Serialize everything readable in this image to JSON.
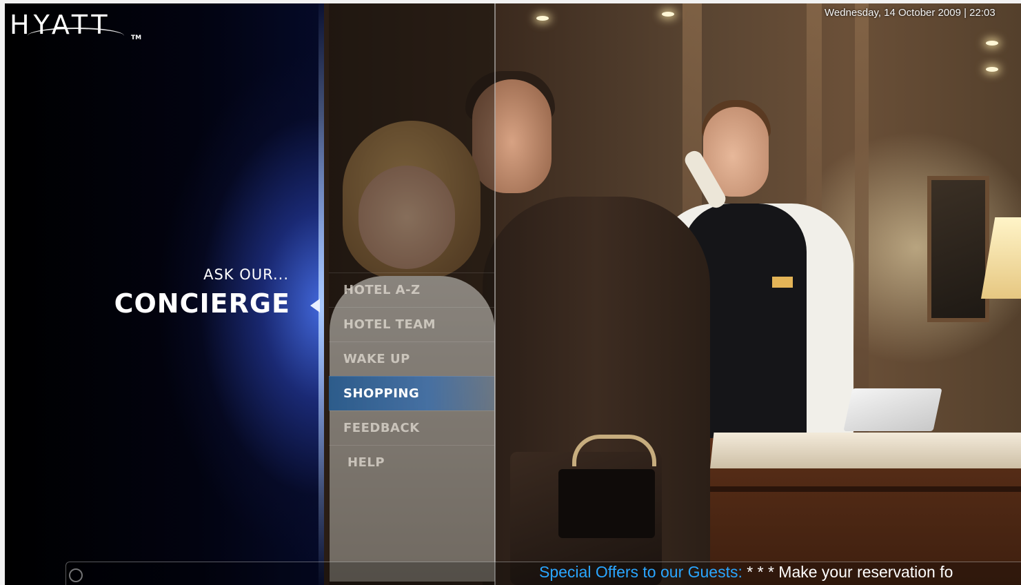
{
  "brand": {
    "logo_text": "HYATT",
    "trademark": "TM"
  },
  "header": {
    "datetime": "Wednesday, 14 October 2009 | 22:03"
  },
  "section": {
    "prefix": "ASK OUR...",
    "title": "CONCIERGE"
  },
  "menu": {
    "selected_index": 3,
    "items": [
      {
        "label": "HOTEL A-Z"
      },
      {
        "label": "HOTEL TEAM"
      },
      {
        "label": "WAKE UP"
      },
      {
        "label": "SHOPPING"
      },
      {
        "label": "FEEDBACK"
      },
      {
        "label": "HELP"
      }
    ]
  },
  "ticker": {
    "label": "Special Offers to our Guests:",
    "message": " * * * Make your reservation fo"
  },
  "colors": {
    "accent_blue": "#2aa6ff",
    "selected_item": "#3c6eaa",
    "sidebar_glow": "#466ee6"
  },
  "icons": {
    "ticker_icon": "circle-icon",
    "pointer": "triangle-left-icon"
  }
}
